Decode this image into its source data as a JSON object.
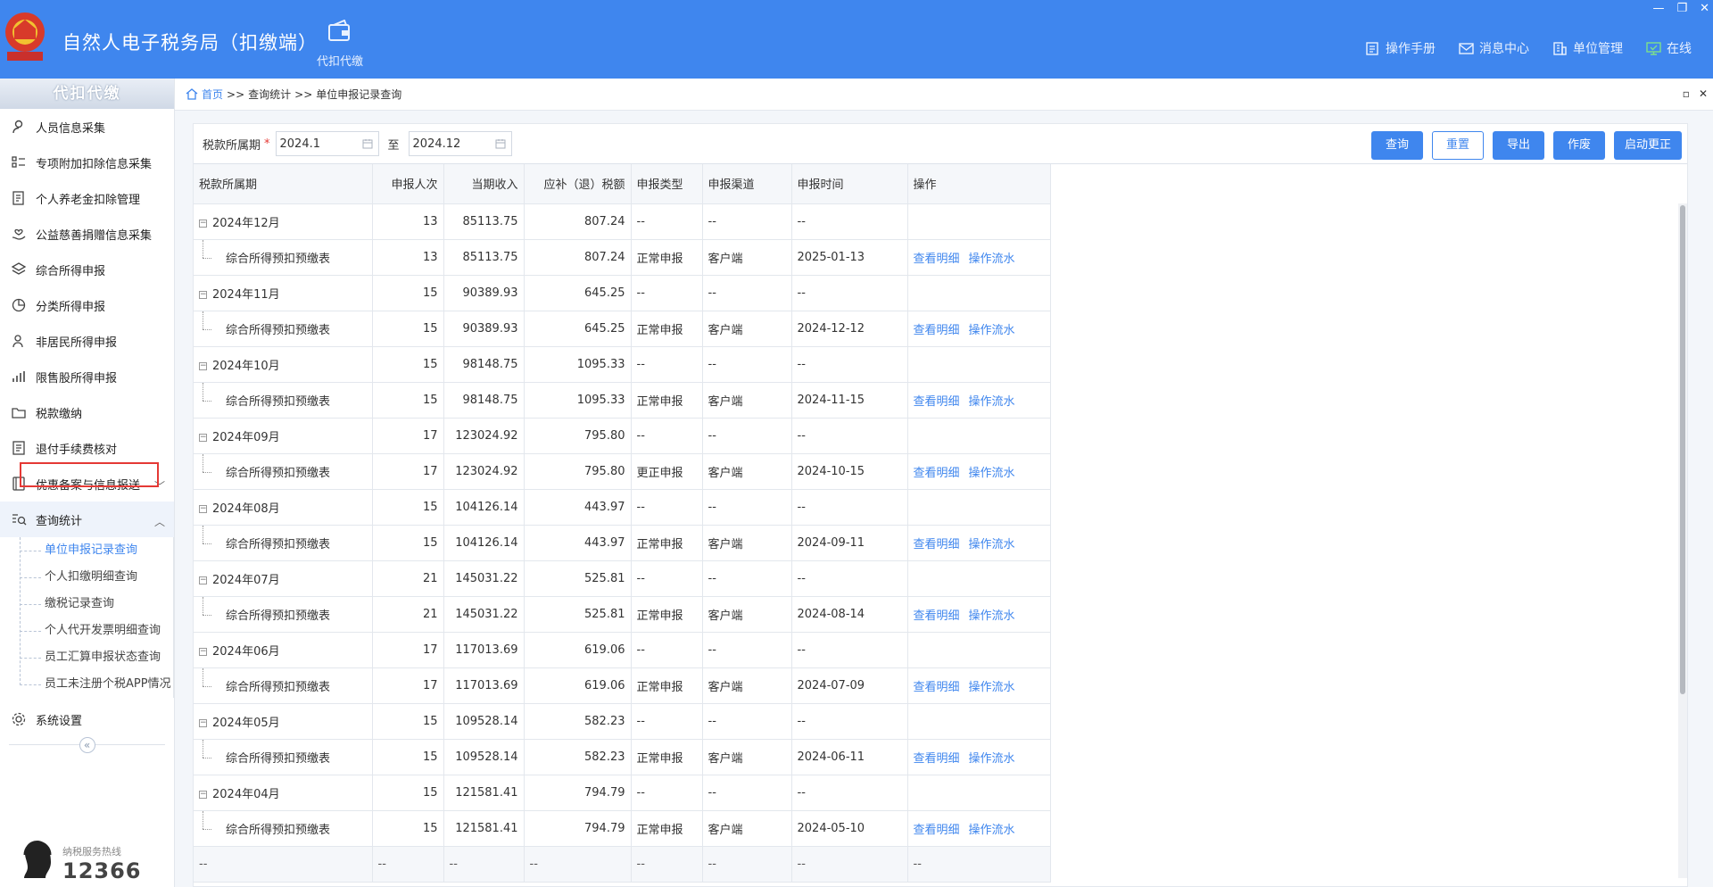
{
  "header": {
    "title": "自然人电子税务局（扣缴端）",
    "module": "代扣代缴",
    "links": [
      {
        "label": "操作手册",
        "icon": "manual-icon"
      },
      {
        "label": "消息中心",
        "icon": "mail-icon"
      },
      {
        "label": "单位管理",
        "icon": "building-icon"
      },
      {
        "label": "在线",
        "icon": "monitor-icon"
      }
    ],
    "window_controls": [
      "—",
      "❐",
      "✕"
    ]
  },
  "sidebar": {
    "title": "代扣代缴",
    "items": [
      {
        "label": "人员信息采集",
        "icon": "person-icon"
      },
      {
        "label": "专项附加扣除信息采集",
        "icon": "list-icon"
      },
      {
        "label": "个人养老金扣除管理",
        "icon": "document-icon"
      },
      {
        "label": "公益慈善捐赠信息采集",
        "icon": "charity-icon"
      },
      {
        "label": "综合所得申报",
        "icon": "layers-icon"
      },
      {
        "label": "分类所得申报",
        "icon": "pie-icon"
      },
      {
        "label": "非居民所得申报",
        "icon": "person-outline-icon"
      },
      {
        "label": "限售股所得申报",
        "icon": "bar-chart-icon"
      },
      {
        "label": "税款缴纳",
        "icon": "folder-icon"
      },
      {
        "label": "退付手续费核对",
        "icon": "checklist-icon"
      },
      {
        "label": "优惠备案与信息报送",
        "icon": "book-icon"
      },
      {
        "label": "查询统计",
        "icon": "search-list-icon"
      }
    ],
    "sub_items": [
      {
        "label": "单位申报记录查询"
      },
      {
        "label": "个人扣缴明细查询"
      },
      {
        "label": "缴税记录查询"
      },
      {
        "label": "个人代开发票明细查询"
      },
      {
        "label": "员工汇算申报状态查询"
      },
      {
        "label": "员工未注册个税APP情况"
      }
    ],
    "settings": {
      "label": "系统设置",
      "icon": "gear-icon"
    },
    "hotline_label": "纳税服务热线",
    "hotline_number": "12366"
  },
  "breadcrumb": {
    "home": "首页",
    "sep": ">>",
    "level1": "查询统计",
    "level2": "单位申报记录查询"
  },
  "filter": {
    "label": "税款所属期",
    "required_mark": "*",
    "start": "2024.1",
    "to": "至",
    "end": "2024.12"
  },
  "buttons": {
    "query": "查询",
    "reset": "重置",
    "export": "导出",
    "void": "作废",
    "correct": "启动更正"
  },
  "table": {
    "headers": [
      "税款所属期",
      "申报人次",
      "当期收入",
      "应补（退）税额",
      "申报类型",
      "申报渠道",
      "申报时间",
      "操作"
    ],
    "action_detail": "查看明细",
    "action_flow": "操作流水",
    "groups": [
      {
        "period": "2024年12月",
        "count": "13",
        "income": "85113.75",
        "tax": "807.24",
        "child": {
          "name": "综合所得预扣预缴表",
          "count": "13",
          "income": "85113.75",
          "tax": "807.24",
          "type": "正常申报",
          "channel": "客户端",
          "time": "2025-01-13"
        }
      },
      {
        "period": "2024年11月",
        "count": "15",
        "income": "90389.93",
        "tax": "645.25",
        "child": {
          "name": "综合所得预扣预缴表",
          "count": "15",
          "income": "90389.93",
          "tax": "645.25",
          "type": "正常申报",
          "channel": "客户端",
          "time": "2024-12-12"
        }
      },
      {
        "period": "2024年10月",
        "count": "15",
        "income": "98148.75",
        "tax": "1095.33",
        "child": {
          "name": "综合所得预扣预缴表",
          "count": "15",
          "income": "98148.75",
          "tax": "1095.33",
          "type": "正常申报",
          "channel": "客户端",
          "time": "2024-11-15"
        }
      },
      {
        "period": "2024年09月",
        "count": "17",
        "income": "123024.92",
        "tax": "795.80",
        "child": {
          "name": "综合所得预扣预缴表",
          "count": "17",
          "income": "123024.92",
          "tax": "795.80",
          "type": "更正申报",
          "channel": "客户端",
          "time": "2024-10-15"
        }
      },
      {
        "period": "2024年08月",
        "count": "15",
        "income": "104126.14",
        "tax": "443.97",
        "child": {
          "name": "综合所得预扣预缴表",
          "count": "15",
          "income": "104126.14",
          "tax": "443.97",
          "type": "正常申报",
          "channel": "客户端",
          "time": "2024-09-11"
        }
      },
      {
        "period": "2024年07月",
        "count": "21",
        "income": "145031.22",
        "tax": "525.81",
        "child": {
          "name": "综合所得预扣预缴表",
          "count": "21",
          "income": "145031.22",
          "tax": "525.81",
          "type": "正常申报",
          "channel": "客户端",
          "time": "2024-08-14"
        }
      },
      {
        "period": "2024年06月",
        "count": "17",
        "income": "117013.69",
        "tax": "619.06",
        "child": {
          "name": "综合所得预扣预缴表",
          "count": "17",
          "income": "117013.69",
          "tax": "619.06",
          "type": "正常申报",
          "channel": "客户端",
          "time": "2024-07-09"
        }
      },
      {
        "period": "2024年05月",
        "count": "15",
        "income": "109528.14",
        "tax": "582.23",
        "child": {
          "name": "综合所得预扣预缴表",
          "count": "15",
          "income": "109528.14",
          "tax": "582.23",
          "type": "正常申报",
          "channel": "客户端",
          "time": "2024-06-11"
        }
      },
      {
        "period": "2024年04月",
        "count": "15",
        "income": "121581.41",
        "tax": "794.79",
        "child": {
          "name": "综合所得预扣预缴表",
          "count": "15",
          "income": "121581.41",
          "tax": "794.79",
          "type": "正常申报",
          "channel": "客户端",
          "time": "2024-05-10"
        }
      }
    ],
    "placeholder": "--"
  },
  "colors": {
    "brand": "#3f86ee",
    "highlight": "#e53935"
  }
}
